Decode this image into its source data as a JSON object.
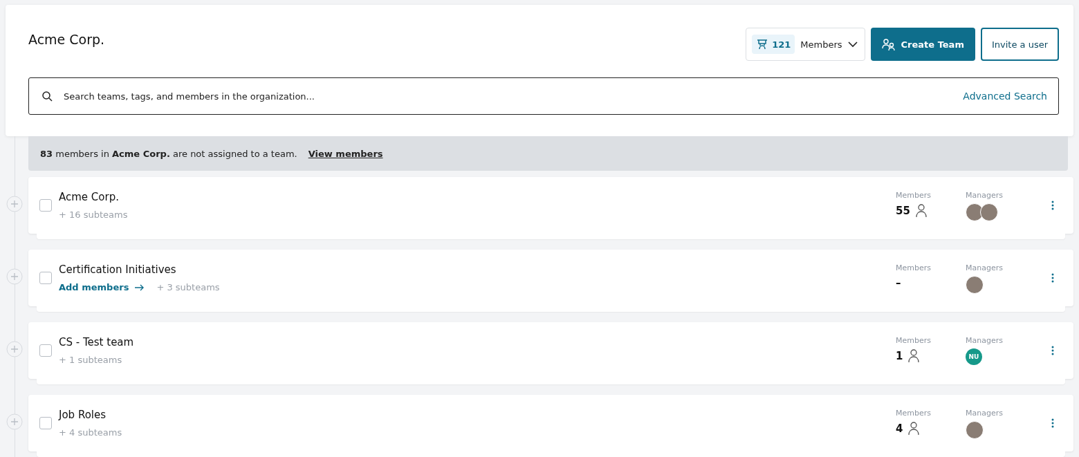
{
  "header": {
    "title": "Acme Corp.",
    "members_count": "121",
    "members_label": "Members",
    "create_button": "Create Team",
    "invite_button": "Invite a user"
  },
  "search": {
    "placeholder": "Search teams, tags, and members in the organization...",
    "advanced": "Advanced Search"
  },
  "banner": {
    "text": "**83** members in **Acme Corp.** are not assigned to a team.",
    "link": "View members"
  },
  "teams": [
    {
      "name": "Acme Corp.",
      "checked": false,
      "subteams": "+ 16 subteams",
      "members_label": "Members",
      "members": "55",
      "managers_label": "Managers",
      "managers": [
        {
          "kind": "photo"
        },
        {
          "kind": "photo"
        }
      ]
    },
    {
      "name": "Certification Initiatives",
      "checked": false,
      "add_members": "Add members",
      "subteams": "+ 3 subteams",
      "members_label": "Members",
      "members": "–",
      "managers_label": "Managers",
      "managers": [
        {
          "kind": "photo"
        }
      ]
    },
    {
      "name": "CS - Test team",
      "checked": false,
      "subteams": "+ 1 subteams",
      "members_label": "Members",
      "members": "1",
      "managers_label": "Managers",
      "managers": [
        {
          "kind": "initials",
          "initials": "NU",
          "color": "#16998a"
        }
      ]
    },
    {
      "name": "Job Roles",
      "checked": false,
      "subteams": "+ 4 subteams",
      "members_label": "Members",
      "members": "4",
      "managers_label": "Managers",
      "managers": [
        {
          "kind": "photo"
        }
      ]
    }
  ]
}
